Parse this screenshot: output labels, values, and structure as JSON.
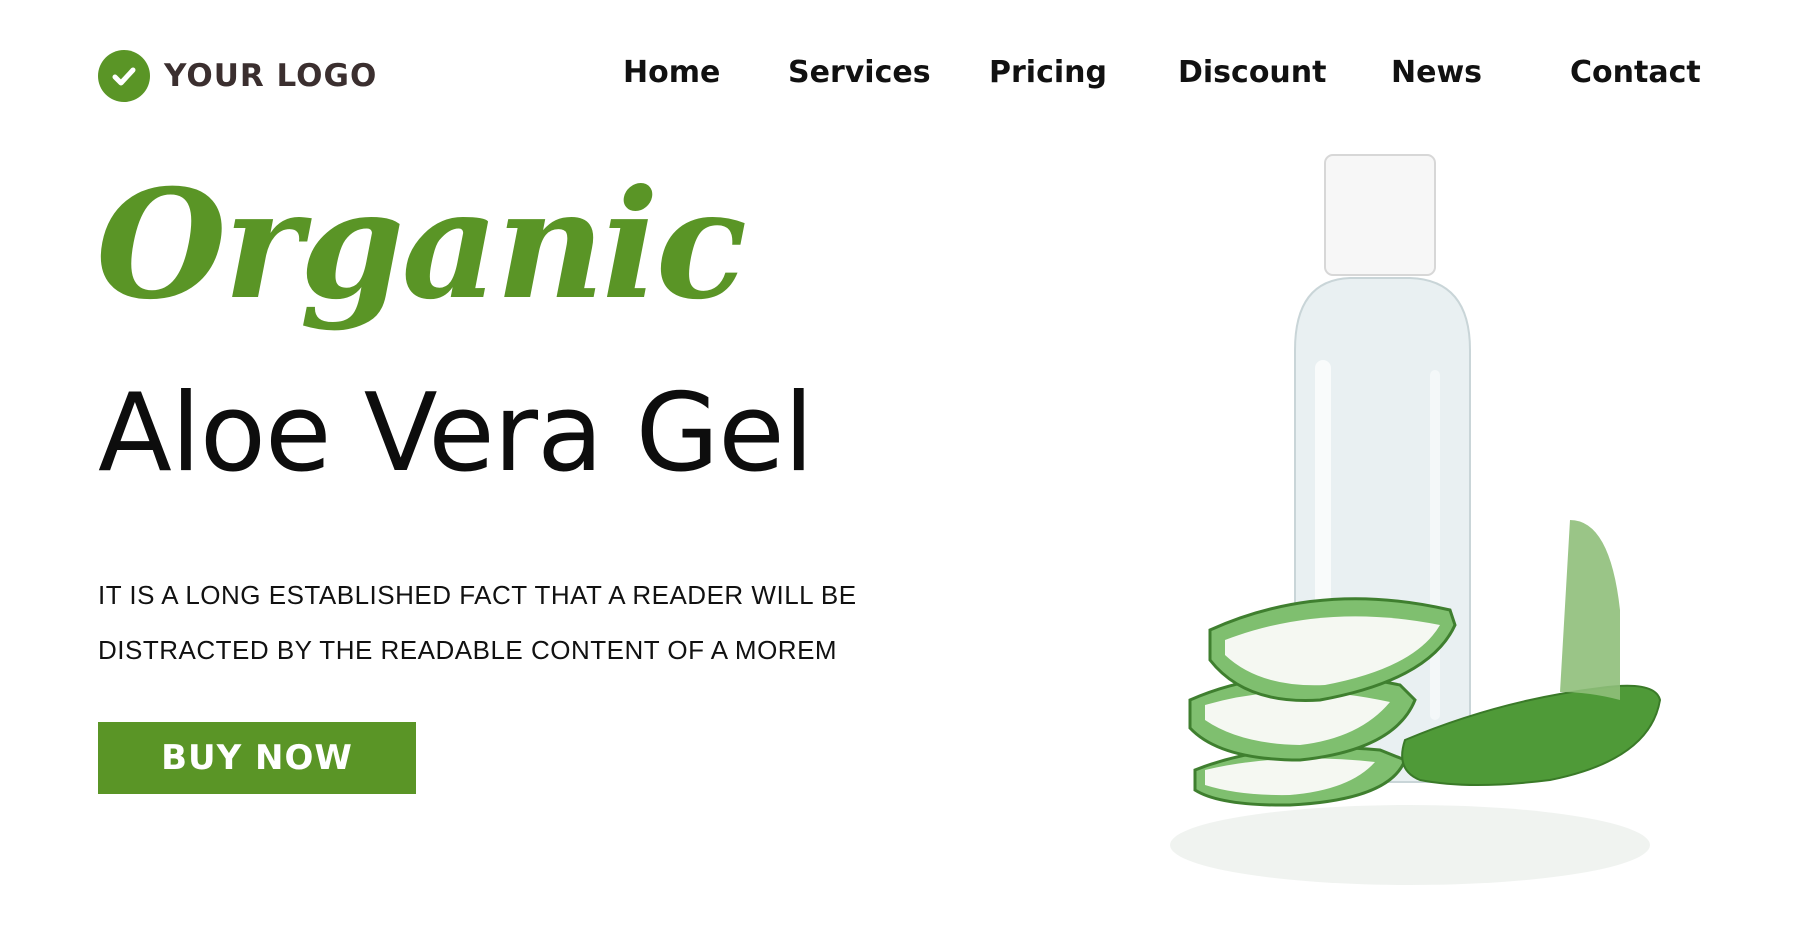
{
  "theme": {
    "accent": "#5a9526",
    "text": "#111111",
    "logo_text_color": "#3b2f2f",
    "leaf_green": "#6fae5a",
    "bottle_tint": "#e8f0f2"
  },
  "header": {
    "logo": {
      "icon": "check-circle-icon",
      "text": "YOUR LOGO"
    },
    "nav": [
      {
        "label": "Home"
      },
      {
        "label": "Services"
      },
      {
        "label": "Pricing"
      },
      {
        "label": "Discount"
      },
      {
        "label": "News"
      },
      {
        "label": "Contact"
      }
    ]
  },
  "hero": {
    "script_title": "Organic",
    "title": "Aloe Vera Gel",
    "description_lines": [
      "IT IS A LONG ESTABLISHED FACT THAT A READER WILL BE",
      "DISTRACTED BY THE READABLE CONTENT OF A MOREM"
    ],
    "button_label": "BUY NOW"
  },
  "product_image": {
    "subject": "aloe-vera-gel-bottle-with-leaves"
  }
}
